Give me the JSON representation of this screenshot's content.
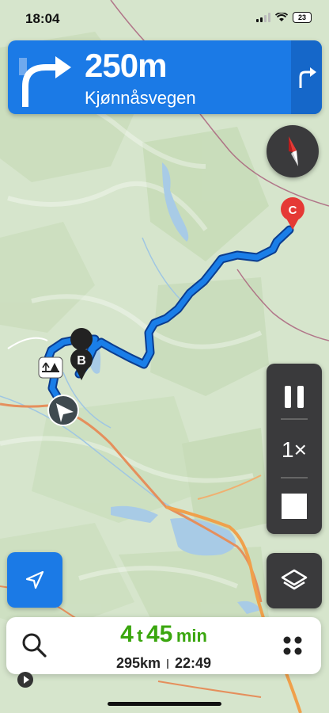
{
  "status_bar": {
    "time": "18:04",
    "battery": "23"
  },
  "navigation": {
    "distance": "250m",
    "street": "Kjønnåsvegen"
  },
  "waypoints": {
    "b": "B",
    "c": "C"
  },
  "playback": {
    "speed": "1×"
  },
  "trip": {
    "hours": "4",
    "hours_unit": "t",
    "minutes": "45",
    "minutes_unit": "min",
    "distance": "295km",
    "arrival": "22:49"
  },
  "colors": {
    "route": "#1a7ee8",
    "accent": "#1b7ae6",
    "eta": "#3aa60e",
    "waypoint_c": "#e53935"
  }
}
